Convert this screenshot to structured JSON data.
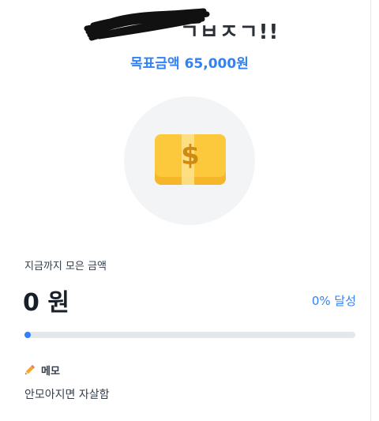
{
  "header": {
    "title_visible": "ㄱㅂㅈㄱ!!",
    "goal_text": "목표금액 65,000원"
  },
  "illustration": {
    "icon": "money-bill-icon",
    "bill_color": "#fbc531",
    "circle_color": "#f2f4f6"
  },
  "savings": {
    "label": "지금까지 모은 금액",
    "amount": "0 원",
    "percent_text": "0% 달성",
    "progress_fraction": 0
  },
  "memo": {
    "icon": "pencil-icon",
    "title": "메모",
    "text": "안모아지면 자살함"
  },
  "colors": {
    "accent": "#3182f6",
    "track": "#e5e8eb",
    "text": "#191f28"
  }
}
